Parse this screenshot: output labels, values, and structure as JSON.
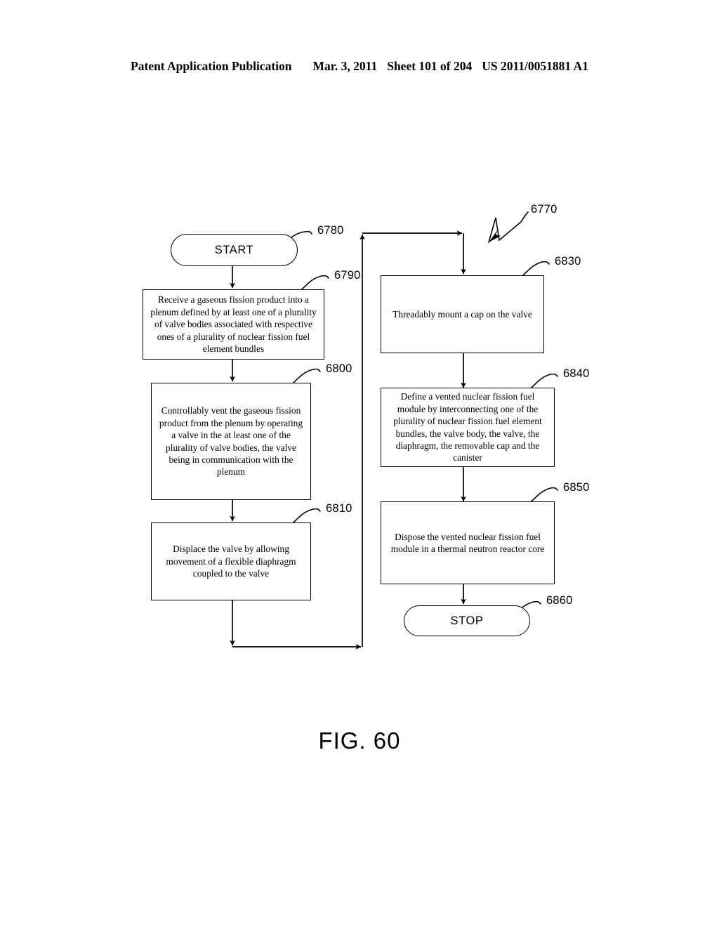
{
  "header": {
    "publication": "Patent Application Publication",
    "date": "Mar. 3, 2011",
    "sheet": "Sheet 101 of 204",
    "patent_number": "US 2011/0051881 A1"
  },
  "figure": {
    "caption": "FIG. 60",
    "diagram_ref": "6770"
  },
  "nodes": {
    "start": {
      "label": "START",
      "ref": "6780"
    },
    "receive": {
      "label": "Receive a gaseous fission product into a plenum defined by at least one of a plurality of valve bodies associated with respective ones of a plurality of nuclear fission fuel element bundles",
      "ref": "6790"
    },
    "vent": {
      "label": "Controllably vent the gaseous fission product from the plenum by operating a valve in the at least one of the plurality of valve bodies, the valve being in communication with the plenum",
      "ref": "6800"
    },
    "displace": {
      "label": "Displace the valve by allowing movement of a flexible diaphragm coupled to the valve",
      "ref": "6810"
    },
    "mount_cap": {
      "label": "Threadably mount a cap on the valve",
      "ref": "6830"
    },
    "define_module": {
      "label": "Define a vented nuclear fission fuel module by interconnecting one of the plurality of nuclear fission fuel element bundles, the valve body, the valve, the diaphragm, the removable cap and the canister",
      "ref": "6840"
    },
    "dispose": {
      "label": "Dispose the vented nuclear fission fuel module in a thermal neutron reactor core",
      "ref": "6850"
    },
    "stop": {
      "label": "STOP",
      "ref": "6860"
    }
  },
  "colors": {
    "ink": "#000000",
    "paper": "#ffffff"
  }
}
